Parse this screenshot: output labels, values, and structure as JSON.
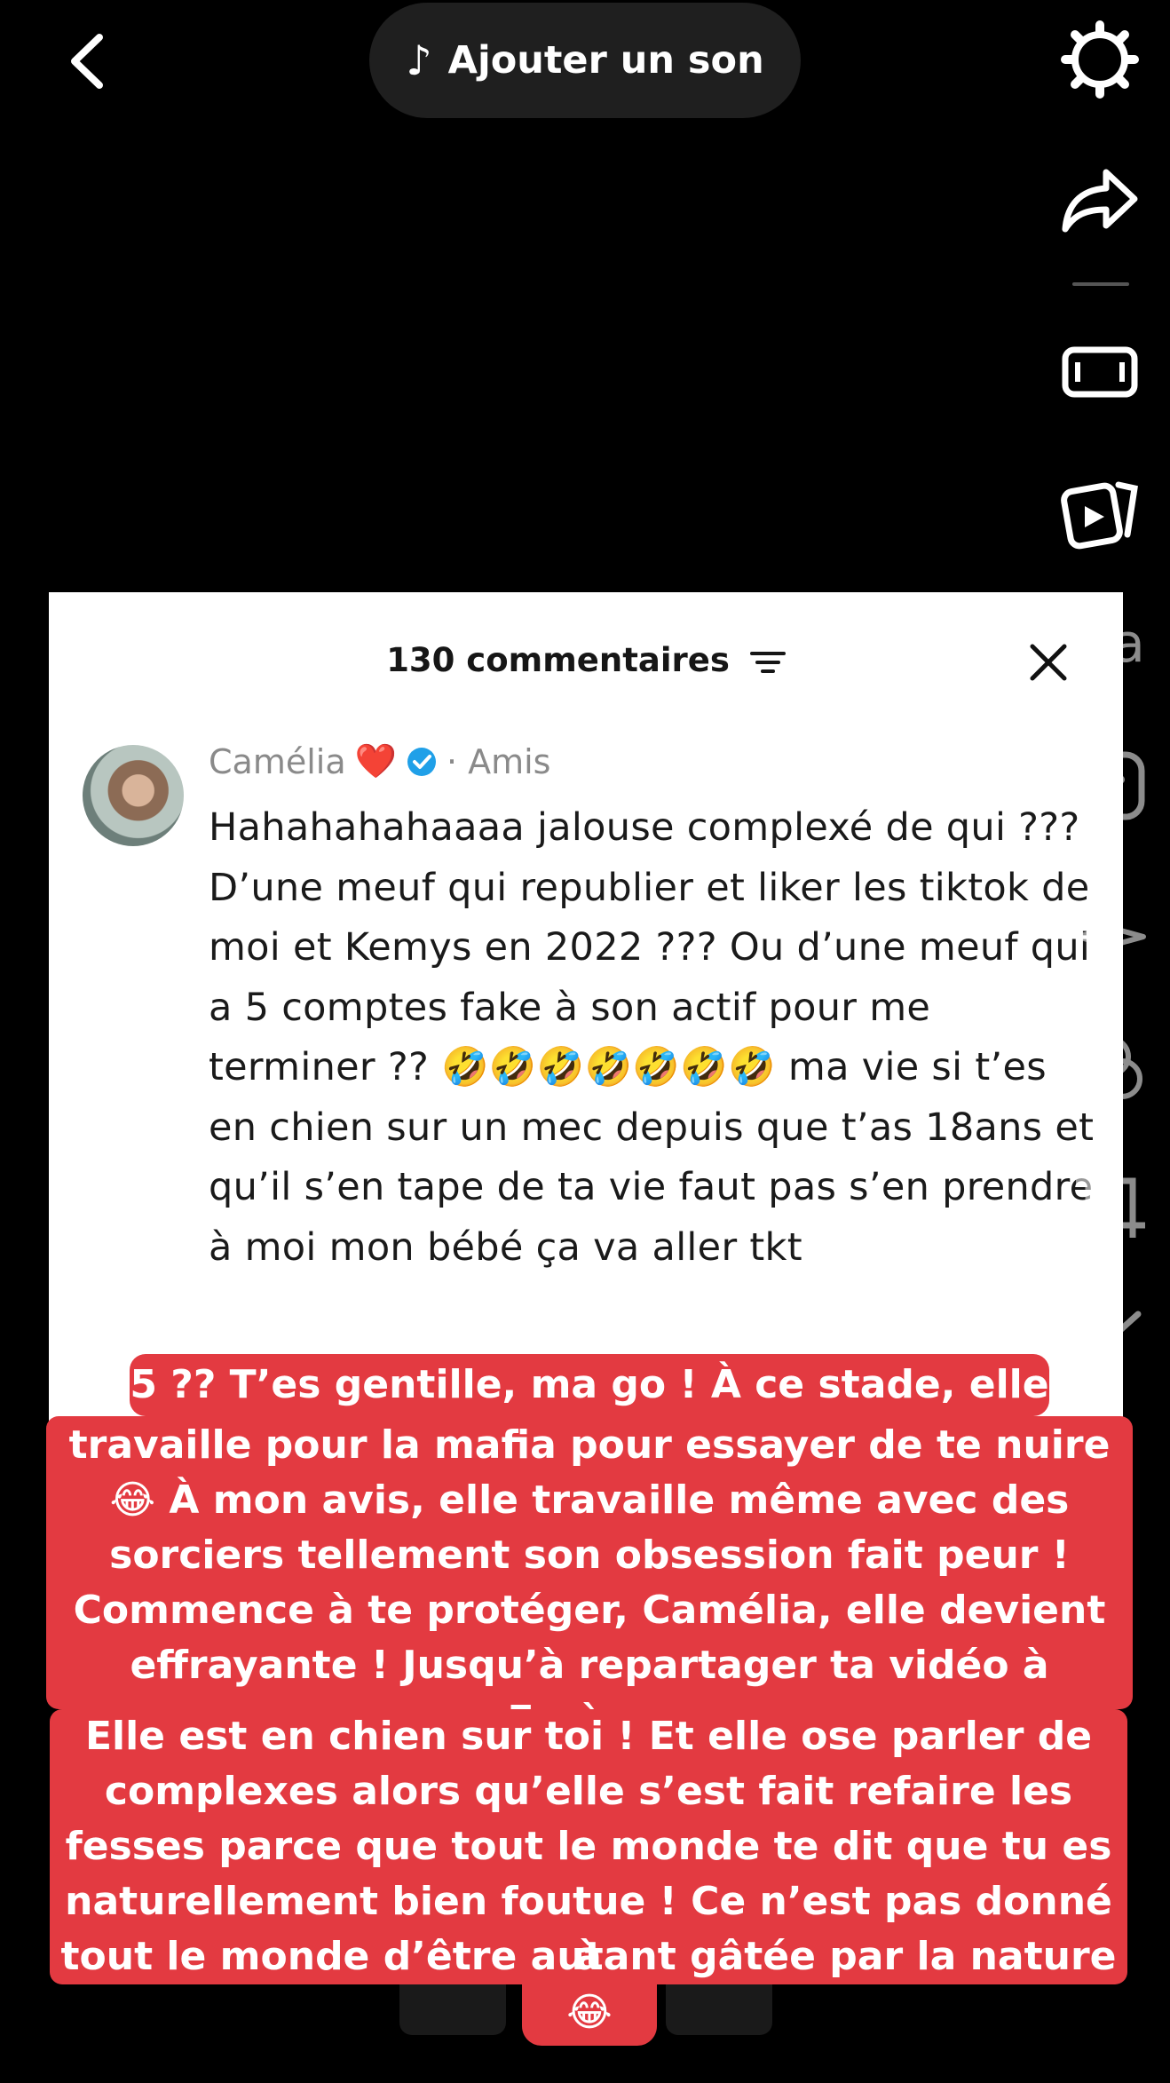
{
  "top_bar": {
    "sound_button_label": "Ajouter un son",
    "note_icon": "♪"
  },
  "comment_panel": {
    "count_label": "130 commentaires",
    "author": "Camélia",
    "heart": "❤️",
    "relation": "· Amis",
    "comment_text": "Hahahahahaaaa jalouse complexé de qui ??? D’une meuf qui republier et liker les tiktok de moi et Kemys en 2022 ??? Ou d’une meuf qui a 5 comptes fake à son actif pour me terminer ?? 🤣🤣🤣🤣🤣🤣🤣 ma vie si t’es en chien sur un mec depuis que t’as 18ans et qu’il s’en tape de ta vie faut pas s’en prendre à moi mon bébé ça va aller tkt"
  },
  "edit_rail": {
    "text_tool_label": "Aa"
  },
  "caption": {
    "line1": "5 ?? T’es gentille, ma go ! À ce stade, elle",
    "line2": "travaille pour la mafia pour essayer de te nuire",
    "line3": "😂 À mon avis, elle travaille même avec des",
    "line4": "sorciers tellement son obsession fait peur !",
    "line5": "Commence à te protéger, Camélia, elle devient",
    "line6": "effrayante ! Jusqu’à repartager ta vidéo à Farès...",
    "line7": "Elle est en chien sur toi ! Et elle ose parler de",
    "line8": "complexes alors qu’elle s’est fait refaire les",
    "line9": "fesses parce que tout le monde te dit que tu es",
    "line10": "naturellement bien foutue ! Ce n’est pas donné à",
    "line11": "tout le monde d’être autant gâtée par la nature !",
    "line12": "😂"
  },
  "colors": {
    "caption_bg": "#e33a41",
    "background": "#000000",
    "card_bg": "#ffffff",
    "verified_blue": "#20a0e8"
  }
}
